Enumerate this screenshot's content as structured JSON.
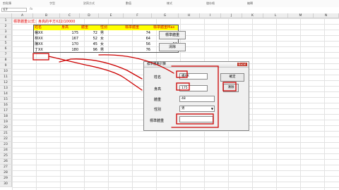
{
  "ribbon": {
    "groups": [
      "剪貼簿",
      "字型",
      "對齊方式",
      "數值",
      "樣式",
      "儲存格",
      "編輯"
    ]
  },
  "formula_bar": {
    "name_box": "E7",
    "fx": "fx",
    "value": ""
  },
  "columns": [
    "A",
    "B",
    "C",
    "D",
    "E",
    "F",
    "G",
    "H",
    "I",
    "J",
    "K",
    "L",
    "M",
    "N"
  ],
  "rows": [
    "1",
    "2",
    "3",
    "4",
    "5",
    "6",
    "7",
    "8",
    "9",
    "10",
    "11",
    "12",
    "13",
    "14",
    "15",
    "16",
    "17",
    "18",
    "19",
    "20",
    "21",
    "22",
    "23",
    "24",
    "25",
    "26",
    "27",
    "28",
    "29",
    "30"
  ],
  "sheet": {
    "title": "標準體重公式：身高的平方X22/10000",
    "headers": [
      "姓名",
      "身高",
      "體重",
      "性別",
      "標準體重",
      "標準體重Max"
    ],
    "rows": [
      [
        "楊XX",
        "175",
        "72",
        "男",
        "74",
        "74"
      ],
      [
        "林XX",
        "167",
        "52",
        "女",
        "64",
        "64"
      ],
      [
        "陳XX",
        "170",
        "45",
        "女",
        "56",
        "56"
      ],
      [
        "丁XX",
        "180",
        "96",
        "男",
        "76",
        "76"
      ]
    ]
  },
  "sheet_buttons": {
    "standard": "標準體重",
    "clear": "清除"
  },
  "dialog": {
    "title": "標準體重計算",
    "close": "Excel",
    "labels": [
      "姓名",
      "身高",
      "體重",
      "性別",
      "標準體重"
    ],
    "values": {
      "name": "楊XX",
      "height": "175",
      "weight": "48",
      "gender": "男",
      "result": ""
    },
    "ok": "確定",
    "cancel": "清除"
  },
  "colors": {
    "annotation": "#cc0000",
    "header_fill": "#ffff00",
    "header_text": "#e00000"
  }
}
